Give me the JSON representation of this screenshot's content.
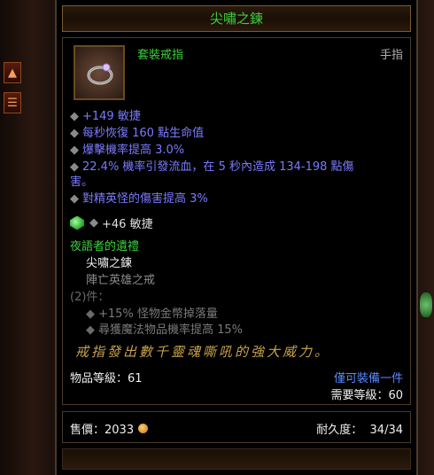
{
  "title": "尖嘯之鍊",
  "item": {
    "type_label": "套裝戒指",
    "slot_label": "手指",
    "icon": "ring-icon"
  },
  "stats": [
    "+149 敏捷",
    "每秒恢復 160 點生命值",
    "爆擊機率提高 3.0%",
    "22.4% 機率引發流血，在 5 秒內造成 134-198 點傷",
    "害。",
    "對精英怪的傷害提高 3%"
  ],
  "gem": {
    "icon": "emerald-gem-icon",
    "bonus": "+46 敏捷"
  },
  "set": {
    "name": "夜語者的遺禮",
    "owned_item": "尖嘯之鍊",
    "missing_item": "陣亡英雄之戒",
    "bonus_header": "(2)件：",
    "bonuses": [
      "+15% 怪物金幣掉落量",
      "尋獲魔法物品機率提高 15%"
    ]
  },
  "flavor": "戒指發出數千靈魂嘶吼的強大威力。",
  "item_level": "物品等級：61",
  "unique_equipped": "僅可裝備一件",
  "required_level": "需要等級：60",
  "footer": {
    "price_label": "售價：2033",
    "durability_label": "耐久度：",
    "durability_value": "34/34"
  },
  "colors": {
    "set_green": "#3ccf3c",
    "magic_blue": "#7a7aff",
    "flavor_gold": "#c8a24a",
    "unique_blue": "#5a8aff"
  }
}
